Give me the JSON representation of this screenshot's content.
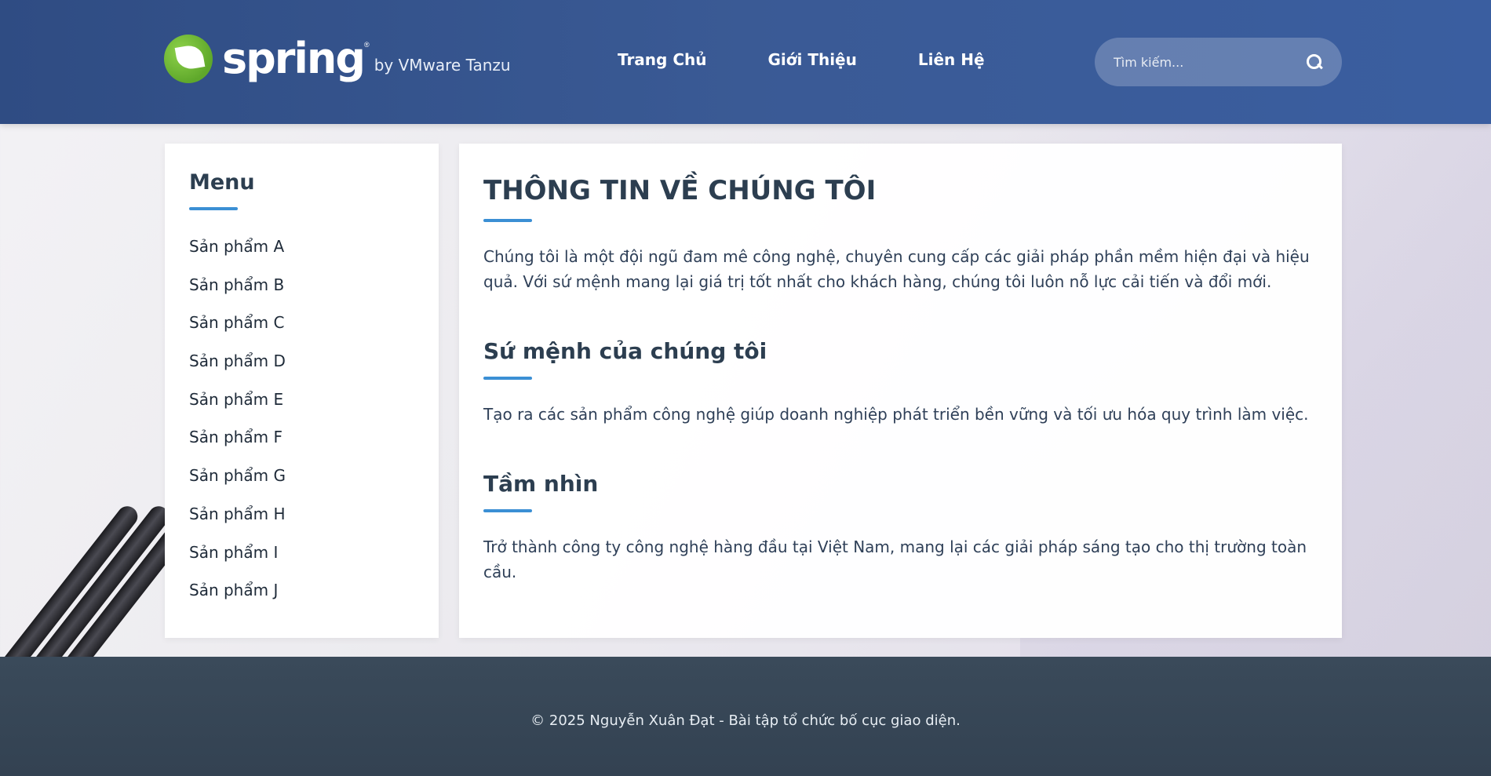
{
  "brand": {
    "name": "spring",
    "registered": "®",
    "tagline": "by VMware Tanzu"
  },
  "nav": {
    "items": [
      "Trang Chủ",
      "Giới Thiệu",
      "Liên Hệ"
    ]
  },
  "search": {
    "placeholder": "Tìm kiếm..."
  },
  "sidebar": {
    "title": "Menu",
    "items": [
      "Sản phẩm A",
      "Sản phẩm B",
      "Sản phẩm C",
      "Sản phẩm D",
      "Sản phẩm E",
      "Sản phẩm F",
      "Sản phẩm G",
      "Sản phẩm H",
      "Sản phẩm I",
      "Sản phẩm J"
    ]
  },
  "main": {
    "title": "THÔNG TIN VỀ CHÚNG TÔI",
    "intro": "Chúng tôi là một đội ngũ đam mê công nghệ, chuyên cung cấp các giải pháp phần mềm hiện đại và hiệu quả. Với sứ mệnh mang lại giá trị tốt nhất cho khách hàng, chúng tôi luôn nỗ lực cải tiến và đổi mới.",
    "mission_title": "Sứ mệnh của chúng tôi",
    "mission_text": "Tạo ra các sản phẩm công nghệ giúp doanh nghiệp phát triển bền vững và tối ưu hóa quy trình làm việc.",
    "vision_title": "Tầm nhìn",
    "vision_text": "Trở thành công ty công nghệ hàng đầu tại Việt Nam, mang lại các giải pháp sáng tạo cho thị trường toàn cầu."
  },
  "footer": {
    "text": "© 2025 Nguyễn Xuân Đạt - Bài tập tổ chức bố cục giao diện."
  },
  "colors": {
    "header_bg": "#3a5a95",
    "accent_underline": "#3b8fd4",
    "footer_bg": "#374757",
    "heading_text": "#2c3e50"
  }
}
